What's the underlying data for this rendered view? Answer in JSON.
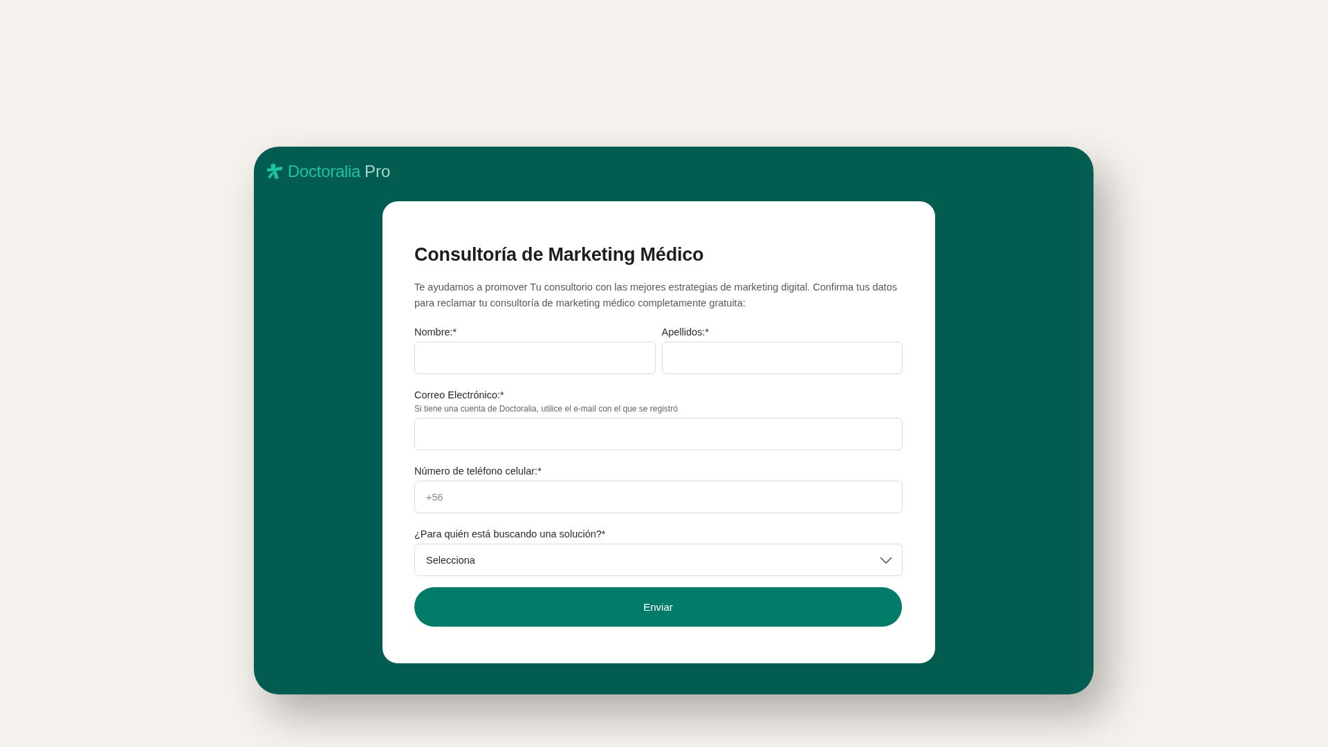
{
  "logo": {
    "brand": "Doctoralia",
    "suffix": "Pro"
  },
  "form": {
    "title": "Consultoría de Marketing Médico",
    "description": "Te ayudamos a promover Tu consultorio con las mejores estrategias de marketing digital. Confirma tus datos para reclamar tu consultoría de marketing médico completamente gratuita:",
    "rows": [
      {
        "fields": [
          {
            "kind": "text",
            "label": "Nombre:*"
          },
          {
            "kind": "text",
            "label": "Apellidos:*"
          }
        ]
      },
      {
        "fields": [
          {
            "kind": "email",
            "label": "Correo Electrónico:*",
            "hint": "Si tiene una cuenta de Doctoralia, utilice el e-mail con el que se registró"
          }
        ]
      },
      {
        "fields": [
          {
            "kind": "tel",
            "label": "Número de teléfono celular:*",
            "placeholder": "+56"
          }
        ]
      },
      {
        "fields": [
          {
            "kind": "select",
            "label": "¿Para quién está buscando una solución?*",
            "value": "Selecciona"
          }
        ]
      }
    ],
    "submit": "Enviar"
  }
}
